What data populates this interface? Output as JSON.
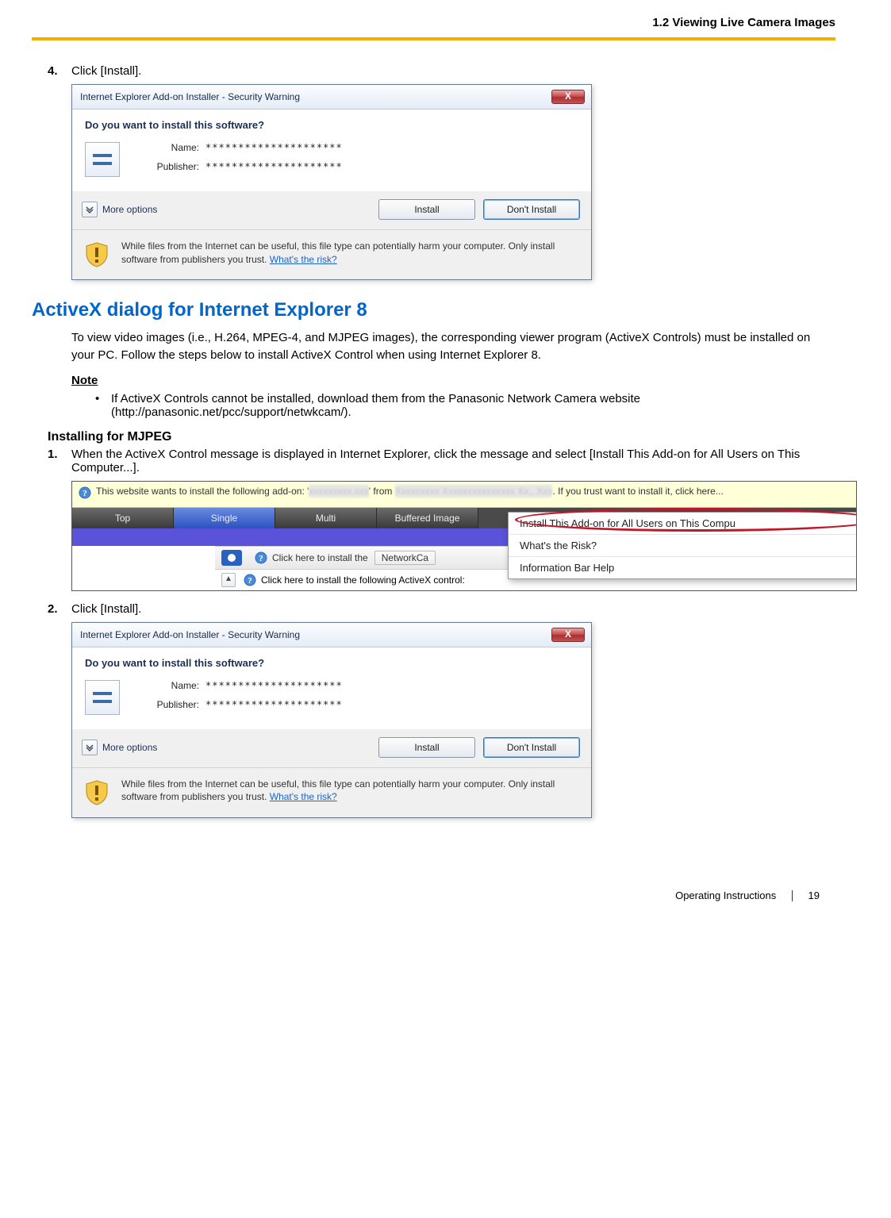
{
  "header": {
    "section": "1.2 Viewing Live Camera Images"
  },
  "step4": {
    "num": "4.",
    "text": "Click [Install]."
  },
  "dialog": {
    "title": "Internet Explorer Add-on Installer - Security Warning",
    "close": "X",
    "question": "Do you want to install this software?",
    "name_label": "Name:",
    "name_value": "*********************",
    "publisher_label": "Publisher:",
    "publisher_value": "*********************",
    "more_options": "More options",
    "install_btn": "Install",
    "dont_install_btn": "Don't Install",
    "warn_text": "While files from the Internet can be useful, this file type can potentially harm your computer. Only install software from publishers you trust. ",
    "warn_link": "What's the risk?"
  },
  "h2": "ActiveX dialog for Internet Explorer 8",
  "intro": "To view video images (i.e., H.264, MPEG-4, and MJPEG images), the corresponding viewer program (ActiveX Controls) must be installed on your PC. Follow the steps below to install ActiveX Control when using Internet Explorer 8.",
  "note_label": "Note",
  "note_bullet": "If ActiveX Controls cannot be installed, download them from the Panasonic Network Camera website (http://panasonic.net/pcc/support/netwkcam/).",
  "sub_h": "Installing for MJPEG",
  "step1": {
    "num": "1.",
    "text": "When the ActiveX Control message is displayed in Internet Explorer, click the message and select [Install This Add-on for All Users on This Computer...]."
  },
  "ie8": {
    "infobar_pre": "This website wants to install the following add-on: '",
    "infobar_blur1": "xxxxxxxxx.xxx",
    "infobar_mid": "' from ",
    "infobar_blur2": "Xxxxxxxxx Xxxxxxxxxxxxxxx Xx., Xxx",
    "infobar_post": ". If you trust want to install it, click here...",
    "tabs": [
      "Top",
      "Single",
      "Multi",
      "Buffered Image"
    ],
    "install_msg1": "Click here to install the",
    "networkca": "NetworkCa",
    "install_msg2": "Click here to install the following ActiveX control:",
    "ctx": {
      "item1": "Install This Add-on for All Users on This Compu",
      "item2": "What's the Risk?",
      "item3": "Information Bar Help"
    }
  },
  "step2": {
    "num": "2.",
    "text": "Click [Install]."
  },
  "footer": {
    "label": "Operating Instructions",
    "page": "19"
  }
}
